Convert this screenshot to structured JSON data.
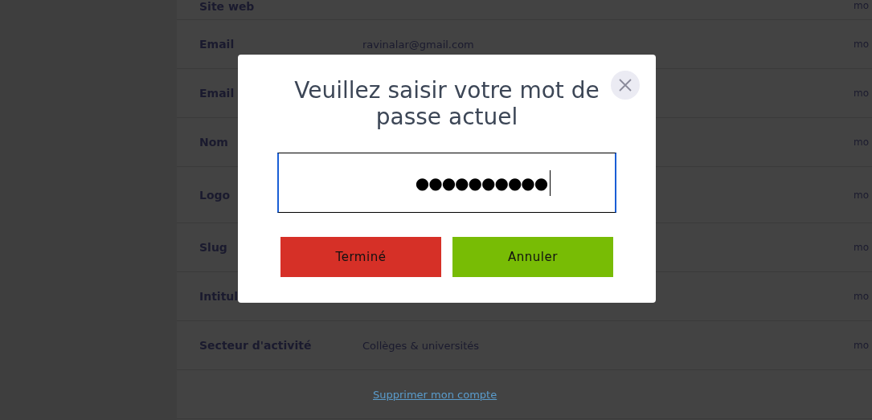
{
  "settings_rows": [
    {
      "label": "Site web",
      "action": "mo"
    },
    {
      "label": "Email",
      "value": "ravinalar@gmail.com",
      "action": "mo"
    },
    {
      "label": "Email",
      "action": "mo"
    },
    {
      "label": "Nom",
      "action": "mo"
    },
    {
      "label": "Logo",
      "action": "mo",
      "tall": true
    },
    {
      "label": "Slug",
      "action": "mo"
    },
    {
      "label": "Intitul",
      "action": "mo"
    },
    {
      "label": "Secteur d'activité",
      "value": "Collèges & universités",
      "action": "mo"
    }
  ],
  "delete_link": "Supprimer mon compte",
  "dialog": {
    "title": "Veuillez saisir votre mot de passe actuel",
    "password": "●●●●●●●●●●",
    "focused": true,
    "buttons": [
      {
        "label": "Terminé",
        "color": "#d63027"
      },
      {
        "label": "Annuler",
        "color": "#78bc05"
      }
    ]
  }
}
